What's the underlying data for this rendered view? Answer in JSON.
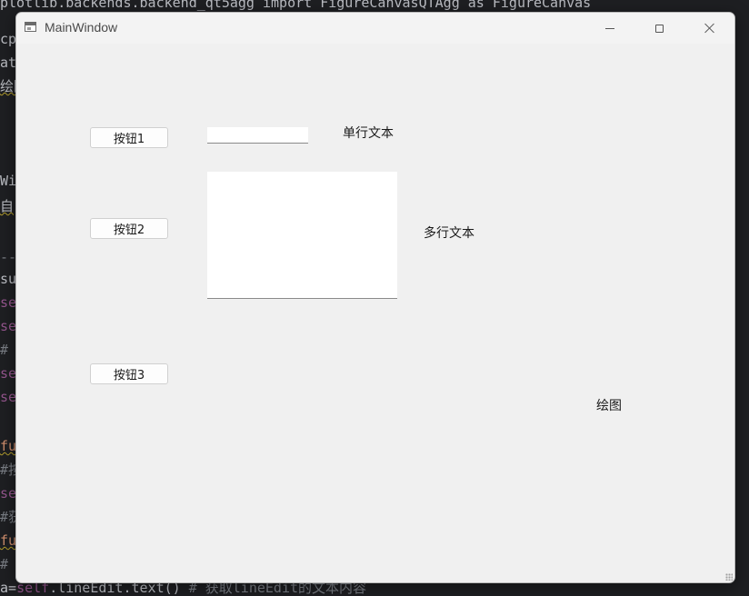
{
  "window": {
    "title": "MainWindow"
  },
  "icons": {
    "app": "app-window-icon",
    "minimize": "minimize-icon",
    "maximize": "maximize-icon",
    "close": "close-icon",
    "grip": "resize-grip-icon"
  },
  "buttons": {
    "button1": "按钮1",
    "button2": "按钮2",
    "button3": "按钮3"
  },
  "line_edit": {
    "value": "",
    "label": "单行文本"
  },
  "text_edit": {
    "value": "",
    "label": "多行文本"
  },
  "drawing": {
    "label": "绘图"
  },
  "code_background": {
    "left_fragments": [
      "ol",
      "cp",
      "at",
      "绘图",
      "Wi",
      "自",
      "--",
      "su",
      "se",
      "se",
      "#",
      "se",
      "se",
      "fu",
      "#按",
      "se",
      "#获",
      "fu",
      "#"
    ],
    "top_line_fragment": "plotlib.backends.backend_qt5agg import FigureCanvasQTAgg as FigureCanvas",
    "bottom_line": {
      "prefix": "a=",
      "self": "self",
      "call": ".lineEdit.text() ",
      "comment": "# 获取lineEdit的文本内容"
    }
  },
  "colors": {
    "window_bg": "#f0f0f0",
    "editor_bg": "#1e1f22"
  }
}
